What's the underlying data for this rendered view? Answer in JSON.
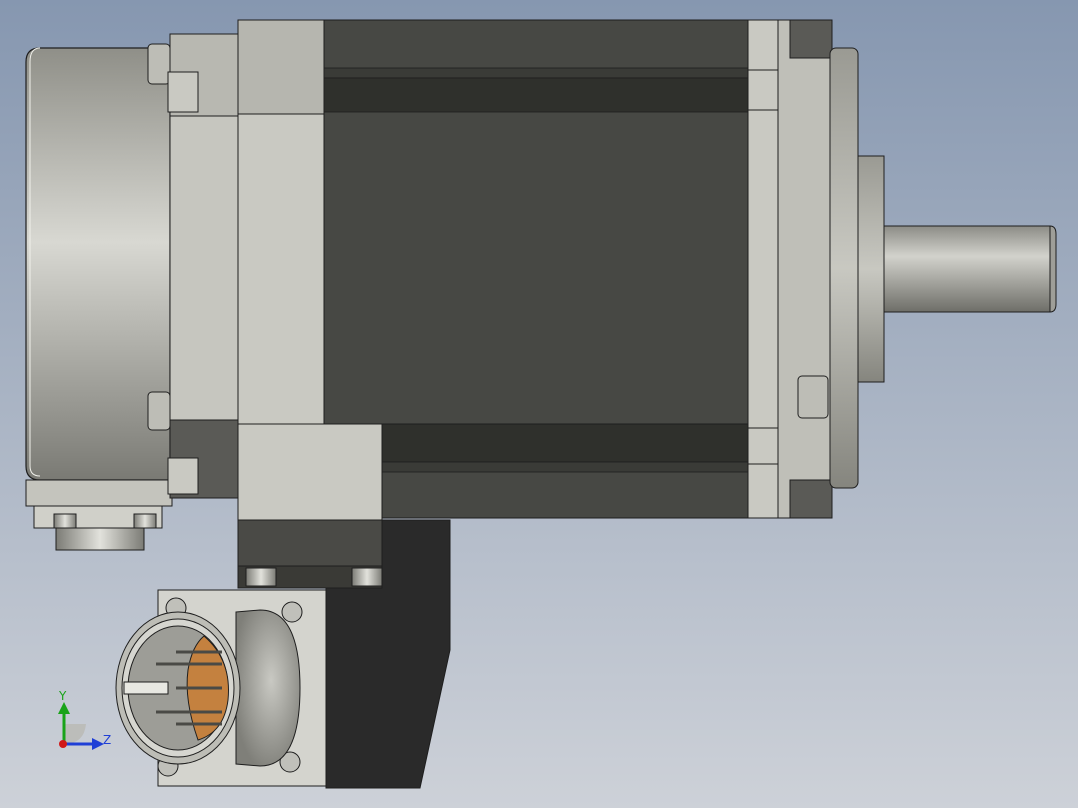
{
  "scene": {
    "subject": "servo-motor-cad-model"
  },
  "triad": {
    "y_label": "Y",
    "z_label": "Z",
    "y_color": "#19a319",
    "z_color": "#1f3fd6",
    "x_color": "#d01818"
  },
  "colors": {
    "background_top": "#8a9bb3",
    "background_bottom": "#c9ced6",
    "motor_body": "#474844",
    "housing_light": "#c9c9c2",
    "housing_mid": "#b3b3ab",
    "encoder_cover": "#a9a9a1",
    "terminal_box_dark": "#2a2a2a",
    "connector_pins_insert": "#c4813f",
    "edge": "#1e1e1e"
  }
}
